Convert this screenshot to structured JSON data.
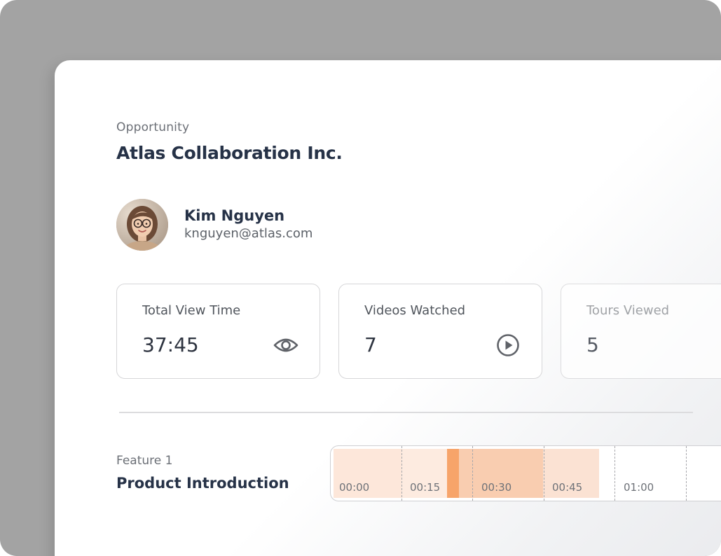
{
  "opportunity": {
    "eyebrow": "Opportunity",
    "name": "Atlas Collaboration Inc."
  },
  "contact": {
    "name": "Kim Nguyen",
    "email": "knguyen@atlas.com",
    "avatar_icon": "user-photo"
  },
  "stats": [
    {
      "label": "Total View Time",
      "value": "37:45",
      "icon": "eye-icon"
    },
    {
      "label": "Videos Watched",
      "value": "7",
      "icon": "play-circle-icon"
    },
    {
      "label": "Tours Viewed",
      "value": "5",
      "icon": ""
    }
  ],
  "feature": {
    "eyebrow": "Feature 1",
    "title": "Product Introduction"
  },
  "timeline": {
    "ticks": [
      "00:00",
      "00:15",
      "00:30",
      "00:45",
      "01:00"
    ],
    "playhead_time": "00:18",
    "colors": {
      "segment_light": "#fde7da",
      "segment_medium": "#f9cdb0",
      "playhead": "#f7a46a"
    }
  },
  "colors": {
    "accent": "#f7a46a",
    "heading": "#263247",
    "backdrop": "#a3a3a3"
  }
}
